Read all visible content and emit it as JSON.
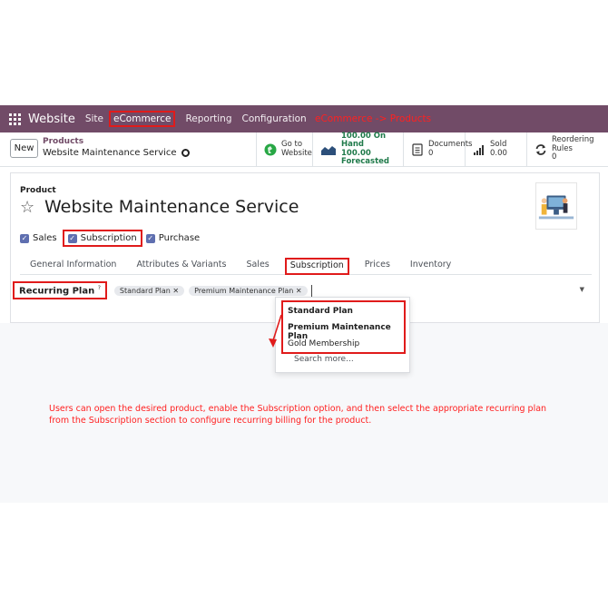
{
  "topnav": {
    "brand": "Website",
    "items": [
      "Site",
      "eCommerce",
      "Reporting",
      "Configuration"
    ],
    "active_index": 1,
    "annotation": "eCommerce -> Products"
  },
  "control_panel": {
    "new_label": "New",
    "breadcrumb_parent": "Products",
    "breadcrumb_current": "Website Maintenance Service",
    "smart_buttons": [
      {
        "icon": "globe-icon",
        "line1": "Go to",
        "line2": "Website"
      },
      {
        "icon": "chart-area-icon",
        "line1": "100.00 On Hand",
        "line2": "100.00 Forecasted"
      },
      {
        "icon": "document-icon",
        "line1": "Documents",
        "line2": "0"
      },
      {
        "icon": "bar-chart-icon",
        "line1": "Sold",
        "line2": "0.00"
      },
      {
        "icon": "refresh-icon",
        "line1": "Reordering Rules",
        "line2": "0"
      }
    ]
  },
  "form": {
    "section_label": "Product",
    "product_name": "Website Maintenance Service",
    "checkboxes": [
      {
        "label": "Sales",
        "checked": true
      },
      {
        "label": "Subscription",
        "checked": true
      },
      {
        "label": "Purchase",
        "checked": true
      }
    ],
    "tabs": [
      "General Information",
      "Attributes & Variants",
      "Sales",
      "Subscription",
      "Prices",
      "Inventory"
    ],
    "active_tab_index": 3,
    "recurring_plan_label": "Recurring Plan",
    "recurring_plan_help": "?",
    "tags": [
      "Standard Plan",
      "Premium Maintenance Plan"
    ]
  },
  "dropdown": {
    "items": [
      {
        "label": "Standard Plan",
        "bold": true
      },
      {
        "label": "Premium Maintenance Plan",
        "bold": true
      },
      {
        "label": "Gold Membership",
        "bold": false
      }
    ],
    "search_more": "Search more..."
  },
  "annotation": "Users can open the desired product, enable the Subscription option, and then select the appropriate recurring plan from the Subscription section to configure recurring billing for the product.",
  "colors": {
    "nav_bg": "#714b67",
    "highlight": "#e01b1b",
    "annotation_text": "#ff2020",
    "checkbox": "#5f6fb0"
  }
}
